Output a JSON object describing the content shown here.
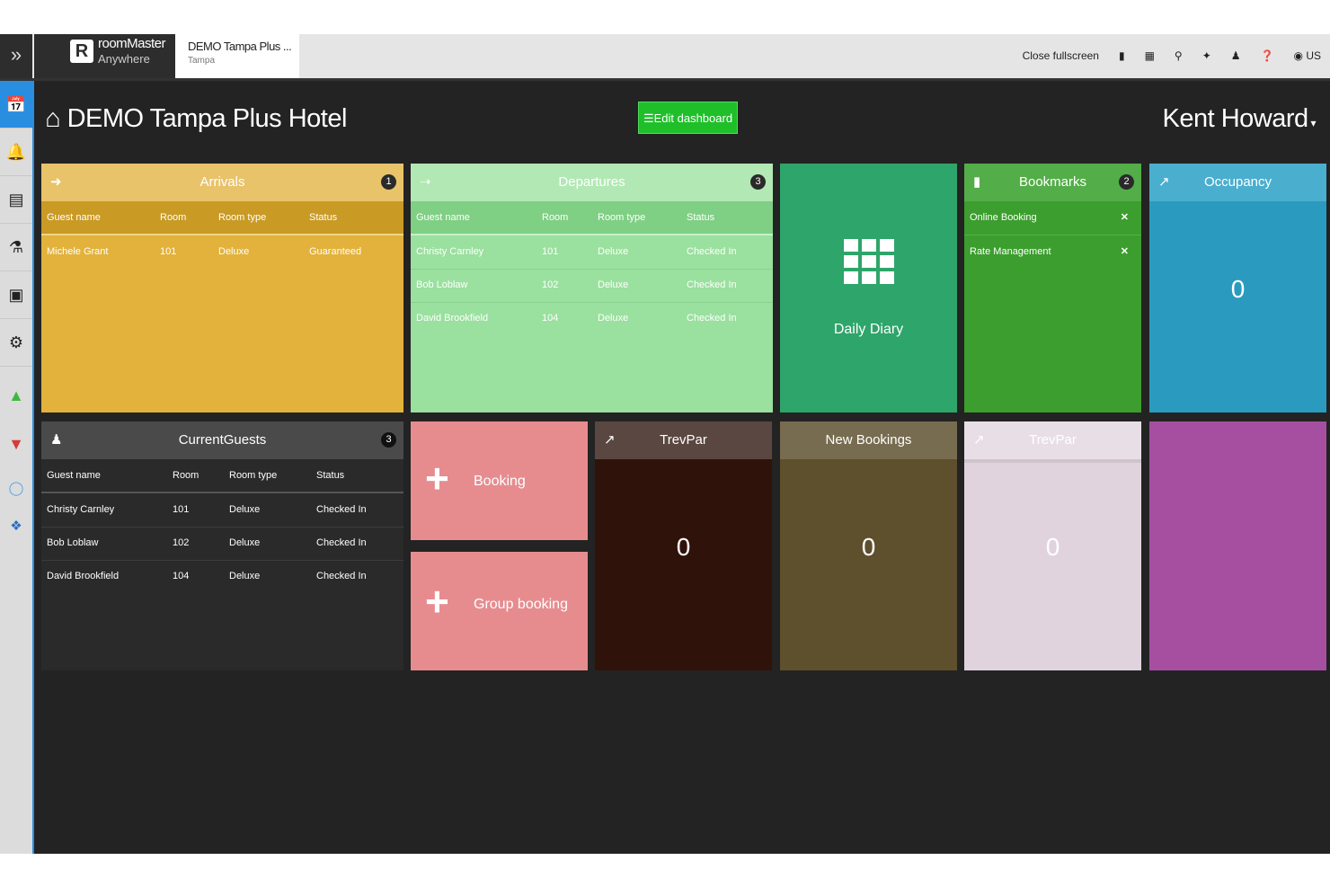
{
  "topbar": {
    "brand_name": "roomMaster",
    "brand_sub": "Anywhere",
    "hotel_tab_title": "DEMO Tampa Plus ...",
    "hotel_tab_sub": "Tampa",
    "close_fullscreen": "Close fullscreen",
    "lang": "US"
  },
  "header": {
    "title": "DEMO Tampa Plus Hotel",
    "edit_button": "Edit dashboard",
    "user": "Kent Howard"
  },
  "arrivals": {
    "title": "Arrivals",
    "count": "1",
    "columns": [
      "Guest name",
      "Room",
      "Room type",
      "Status"
    ],
    "rows": [
      [
        "Michele Grant",
        "101",
        "Deluxe",
        "Guaranteed"
      ]
    ]
  },
  "departures": {
    "title": "Departures",
    "count": "3",
    "columns": [
      "Guest name",
      "Room",
      "Room type",
      "Status"
    ],
    "rows": [
      [
        "Christy Carnley",
        "101",
        "Deluxe",
        "Checked In"
      ],
      [
        "Bob Loblaw",
        "102",
        "Deluxe",
        "Checked In"
      ],
      [
        "David Brookfield",
        "104",
        "Deluxe",
        "Checked In"
      ]
    ]
  },
  "daily_diary": {
    "label": "Daily Diary"
  },
  "bookmarks": {
    "title": "Bookmarks",
    "count": "2",
    "items": [
      "Online Booking",
      "Rate Management"
    ]
  },
  "occupancy": {
    "title": "Occupancy",
    "value": "0"
  },
  "current_guests": {
    "title": "CurrentGuests",
    "count": "3",
    "columns": [
      "Guest name",
      "Room",
      "Room type",
      "Status"
    ],
    "rows": [
      [
        "Christy Carnley",
        "101",
        "Deluxe",
        "Checked In"
      ],
      [
        "Bob Loblaw",
        "102",
        "Deluxe",
        "Checked In"
      ],
      [
        "David Brookfield",
        "104",
        "Deluxe",
        "Checked In"
      ]
    ]
  },
  "booking": {
    "label": "Booking"
  },
  "group_booking": {
    "label": "Group booking"
  },
  "trevpar1": {
    "title": "TrevPar",
    "value": "0"
  },
  "new_bookings": {
    "title": "New Bookings",
    "value": "0"
  },
  "trevpar2": {
    "title": "TrevPar",
    "value": "0"
  },
  "colors": {
    "arrivals": "#e2b23c",
    "departures": "#9ae09e",
    "daily_diary": "#2ea56a",
    "bookmarks": "#3b9e2e",
    "occupancy": "#2a9bbf",
    "booking": "#e68c8f",
    "trevpar_dark": "#2f130b",
    "new_bookings": "#5e4f2d",
    "trevpar_light": "#e0d3de",
    "purple": "#a64fa1",
    "edit_button": "#1fbf2a"
  }
}
